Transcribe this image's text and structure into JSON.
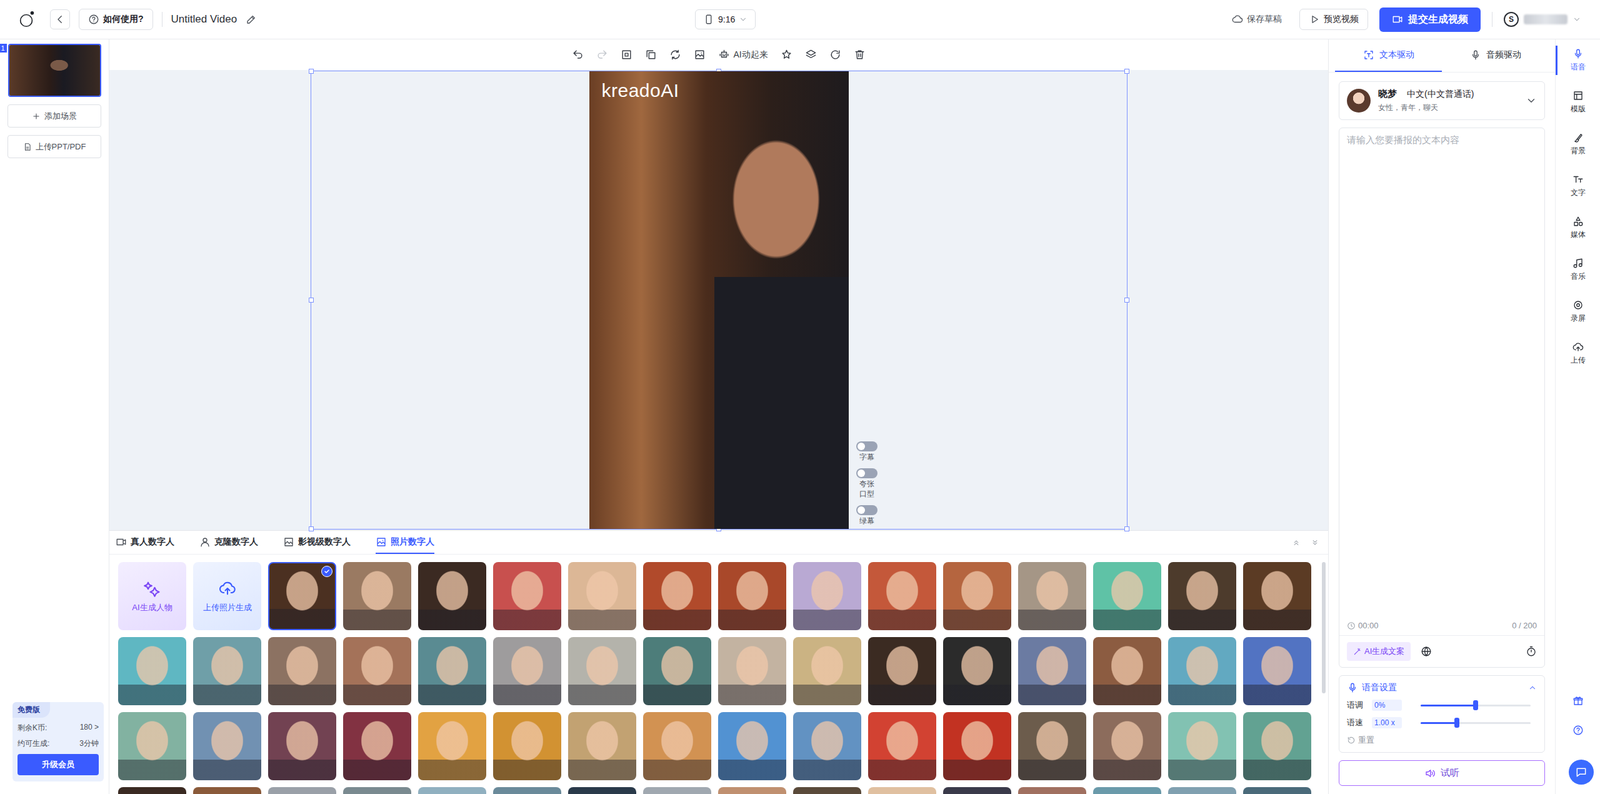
{
  "topbar": {
    "help": "如何使用?",
    "title": "Untitled Video",
    "ratio": "9:16",
    "save": "保存草稿",
    "preview": "预览视频",
    "submit": "提交生成视频",
    "user_initial": "S"
  },
  "scenes": [
    {
      "index": "1",
      "selected": true
    }
  ],
  "sidebar": {
    "add_scene": "添加场景",
    "upload": "上传PPT/PDF"
  },
  "plan": {
    "badge": "免费版",
    "rows": [
      {
        "label": "剩余K币:",
        "value": "180 >"
      },
      {
        "label": "约可生成:",
        "value": "3分钟"
      }
    ],
    "upgrade": "升级会员"
  },
  "toolbar": [
    {
      "kind": "undo",
      "disabled": false,
      "label": ""
    },
    {
      "kind": "redo",
      "disabled": true,
      "label": ""
    },
    {
      "kind": "crop",
      "disabled": false,
      "label": ""
    },
    {
      "kind": "copy",
      "disabled": false,
      "label": ""
    },
    {
      "kind": "swap",
      "disabled": false,
      "label": ""
    },
    {
      "kind": "image",
      "disabled": false,
      "label": ""
    },
    {
      "kind": "ai",
      "disabled": false,
      "label": "AI动起来"
    },
    {
      "kind": "effect",
      "disabled": false,
      "label": ""
    },
    {
      "kind": "layers",
      "disabled": false,
      "label": ""
    },
    {
      "kind": "rotate",
      "disabled": false,
      "label": ""
    },
    {
      "kind": "delete",
      "disabled": false,
      "label": ""
    }
  ],
  "canvas": {
    "watermark": "kreadoAI",
    "toggles": [
      {
        "label": "字幕",
        "on": false
      },
      {
        "label": "夸张口型",
        "on": false
      },
      {
        "label": "绿幕",
        "on": false
      }
    ]
  },
  "library": {
    "tabs": [
      {
        "label": "真人数字人",
        "selected": false
      },
      {
        "label": "克隆数字人",
        "selected": false
      },
      {
        "label": "影视级数字人",
        "selected": false
      },
      {
        "label": "照片数字人",
        "selected": true
      }
    ],
    "actions": [
      {
        "label": "AI生成人物",
        "kind": "ai"
      },
      {
        "label": "上传照片生成",
        "kind": "upload"
      }
    ],
    "avatars": [
      {
        "color": "#4b3021",
        "selected": true
      },
      {
        "color": "#9a7a62",
        "selected": false
      },
      {
        "color": "#3b2a22",
        "selected": false
      },
      {
        "color": "#c8504e",
        "selected": false
      },
      {
        "color": "#dcb796",
        "selected": false
      },
      {
        "color": "#b14a2b",
        "selected": false
      },
      {
        "color": "#a9482a",
        "selected": false
      },
      {
        "color": "#b9a9d3",
        "selected": false
      },
      {
        "color": "#c4583a",
        "selected": false
      },
      {
        "color": "#b5653f",
        "selected": false
      },
      {
        "color": "#a59686",
        "selected": false
      },
      {
        "color": "#5fc2a6",
        "selected": false
      },
      {
        "color": "#4d3b2c",
        "selected": false
      },
      {
        "color": "#5b3b24",
        "selected": false
      },
      {
        "color": "#5fb7c2",
        "selected": false
      },
      {
        "color": "#6f9fa8",
        "selected": false
      },
      {
        "color": "#8c7262",
        "selected": false
      },
      {
        "color": "#a47259",
        "selected": false
      },
      {
        "color": "#5a8b92",
        "selected": false
      },
      {
        "color": "#9e9c9d",
        "selected": false
      },
      {
        "color": "#b4b3ab",
        "selected": false
      },
      {
        "color": "#4d7d7a",
        "selected": false
      },
      {
        "color": "#c3b3a1",
        "selected": false
      },
      {
        "color": "#cbb383",
        "selected": false
      },
      {
        "color": "#3b2b22",
        "selected": false
      },
      {
        "color": "#2b2b2b",
        "selected": false
      },
      {
        "color": "#6b7ba2",
        "selected": false
      },
      {
        "color": "#8c5c41",
        "selected": false
      },
      {
        "color": "#62a9c1",
        "selected": false
      },
      {
        "color": "#5273c2",
        "selected": false
      },
      {
        "color": "#82b2a1",
        "selected": false
      },
      {
        "color": "#7191b2",
        "selected": false
      },
      {
        "color": "#724252",
        "selected": false
      },
      {
        "color": "#823242",
        "selected": false
      },
      {
        "color": "#e2a242",
        "selected": false
      },
      {
        "color": "#d29232",
        "selected": false
      },
      {
        "color": "#c2a272",
        "selected": false
      },
      {
        "color": "#d29252",
        "selected": false
      },
      {
        "color": "#5292d2",
        "selected": false
      },
      {
        "color": "#6292c2",
        "selected": false
      },
      {
        "color": "#d24232",
        "selected": false
      },
      {
        "color": "#c23222",
        "selected": false
      },
      {
        "color": "#6c5c4c",
        "selected": false
      },
      {
        "color": "#8c6c5c",
        "selected": false
      },
      {
        "color": "#82c2b2",
        "selected": false
      },
      {
        "color": "#62a292",
        "selected": false
      },
      {
        "color": "#3a2a22",
        "selected": false
      },
      {
        "color": "#8a5a3a",
        "selected": false
      },
      {
        "color": "#9aa0a8",
        "selected": false
      },
      {
        "color": "#7a8a90",
        "selected": false
      },
      {
        "color": "#90b0c0",
        "selected": false
      },
      {
        "color": "#6a8a9a",
        "selected": false
      },
      {
        "color": "#2a3a4a",
        "selected": false
      },
      {
        "color": "#a0a8b0",
        "selected": false
      },
      {
        "color": "#c09070",
        "selected": false
      },
      {
        "color": "#5a4a3a",
        "selected": false
      },
      {
        "color": "#e0c0a0",
        "selected": false
      },
      {
        "color": "#3a3a4a",
        "selected": false
      },
      {
        "color": "#a07060",
        "selected": false
      },
      {
        "color": "#6a9aaa",
        "selected": false
      },
      {
        "color": "#80a0b0",
        "selected": false
      },
      {
        "color": "#4a6a7a",
        "selected": false
      }
    ]
  },
  "panel": {
    "tabs": [
      {
        "label": "文本驱动",
        "selected": true
      },
      {
        "label": "音频驱动",
        "selected": false
      }
    ],
    "voice": {
      "name": "晓梦",
      "language": "中文(中文普通话)",
      "tags": "女性，青年，聊天"
    },
    "text": {
      "placeholder": "请输入您要播报的文本内容",
      "time": "00:00",
      "count": "0 / 200",
      "ai_button": "AI生成文案"
    },
    "settings": {
      "title": "语音设置",
      "expanded": true,
      "rows": [
        {
          "label": "语调",
          "value": "0%",
          "level": 0.5
        },
        {
          "label": "语速",
          "value": "1.00 x",
          "level": 0.33
        }
      ],
      "reset": "重置"
    },
    "trial": "试听"
  },
  "rail": [
    {
      "label": "语音",
      "selected": true
    },
    {
      "label": "模版",
      "selected": false
    },
    {
      "label": "背景",
      "selected": false
    },
    {
      "label": "文字",
      "selected": false
    },
    {
      "label": "媒体",
      "selected": false
    },
    {
      "label": "音乐",
      "selected": false
    },
    {
      "label": "录屏",
      "selected": false
    },
    {
      "label": "上传",
      "selected": false
    }
  ]
}
